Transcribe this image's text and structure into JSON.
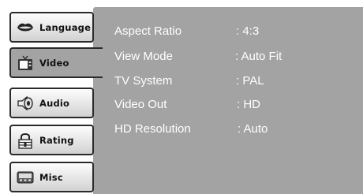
{
  "sidebar": {
    "tabs": [
      {
        "label": "Language",
        "icon": "lips-icon",
        "active": false
      },
      {
        "label": "Video",
        "icon": "tv-icon",
        "active": true
      },
      {
        "label": "Audio",
        "icon": "speaker-icon",
        "active": false
      },
      {
        "label": "Rating",
        "icon": "lock-icon",
        "active": false
      },
      {
        "label": "Misc",
        "icon": "keyboard-icon",
        "active": false
      }
    ]
  },
  "settings": [
    {
      "label": "Aspect Ratio",
      "value": ":  4:3"
    },
    {
      "label": "View Mode",
      "value": ": Auto Fit"
    },
    {
      "label": "TV System",
      "value": ": PAL"
    },
    {
      "label": "Video Out",
      "value": ": HD"
    },
    {
      "label": "HD Resolution",
      "value": ": Auto"
    }
  ],
  "colors": {
    "panel": "#a3a3a3",
    "text": "#ffffff",
    "tab_border": "#2a2a2a"
  }
}
